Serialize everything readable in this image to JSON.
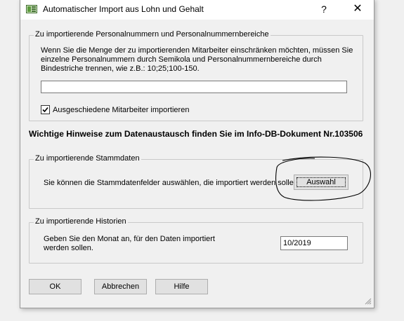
{
  "window": {
    "title": "Automatischer Import aus Lohn und Gehalt",
    "help_glyph": "?",
    "close_glyph": "✕"
  },
  "personal_group": {
    "legend": "Zu importierende Personalnummern und Personalnummernbereiche",
    "description": "Wenn Sie die Menge der zu importierenden Mitarbeiter einschränken möchten, müssen Sie einzelne Personalnummern durch Semikola und Personalnummernbereiche durch Bindestriche trennen, wie z.B.: 10;25;100-150.",
    "input_value": "",
    "checkbox_checked": true,
    "checkbox_label": "Ausgeschiedene Mitarbeiter importieren"
  },
  "note": "Wichtige Hinweise zum Datenaustausch finden Sie im Info-DB-Dokument Nr.103506",
  "stammdaten_group": {
    "legend": "Zu importierende Stammdaten",
    "description": "Sie können die Stammdatenfelder auswählen, die importiert werden sollen.",
    "button_label": "Auswahl"
  },
  "historien_group": {
    "legend": "Zu importierende Historien",
    "description": "Geben Sie den Monat an, für den Daten importiert werden sollen.",
    "month_value": "10/2019"
  },
  "buttons": {
    "ok": "OK",
    "cancel": "Abbrechen",
    "help": "Hilfe"
  }
}
